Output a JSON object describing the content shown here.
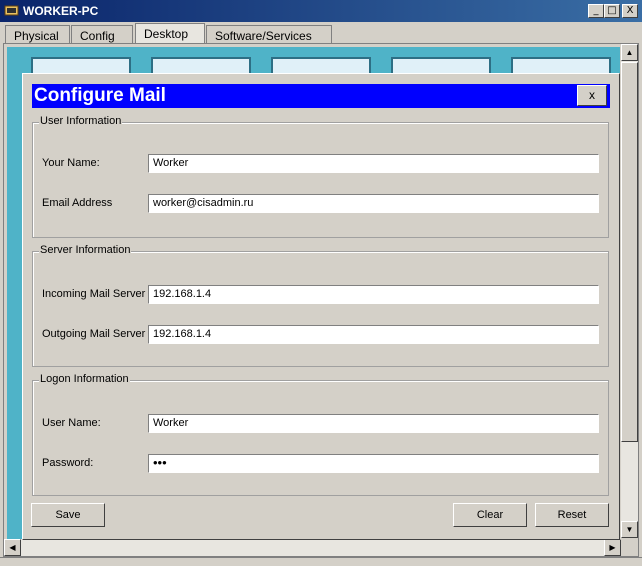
{
  "window": {
    "title": "WORKER-PC",
    "minimize": "_",
    "maximize": "□",
    "close": "X"
  },
  "tabs": [
    {
      "label": "Physical"
    },
    {
      "label": "Config"
    },
    {
      "label": "Desktop"
    },
    {
      "label": "Software/Services"
    }
  ],
  "active_tab": "Desktop",
  "dialog": {
    "title": "Configure Mail",
    "close_label": "x",
    "user_info": {
      "legend": "User Information",
      "your_name_label": "Your Name:",
      "your_name_value": "Worker",
      "email_label": "Email Address",
      "email_value": "worker@cisadmin.ru"
    },
    "server_info": {
      "legend": "Server Information",
      "incoming_label": "Incoming Mail Server",
      "incoming_value": "192.168.1.4",
      "outgoing_label": "Outgoing Mail Server",
      "outgoing_value": "192.168.1.4"
    },
    "logon_info": {
      "legend": "Logon Information",
      "username_label": "User Name:",
      "username_value": "Worker",
      "password_label": "Password:",
      "password_value": "•••"
    },
    "buttons": {
      "save": "Save",
      "clear": "Clear",
      "reset": "Reset"
    }
  },
  "colors": {
    "titlebar": "#0a246a",
    "dialog_title": "#0000ff",
    "desktop_bg": "#4fb3c8"
  }
}
